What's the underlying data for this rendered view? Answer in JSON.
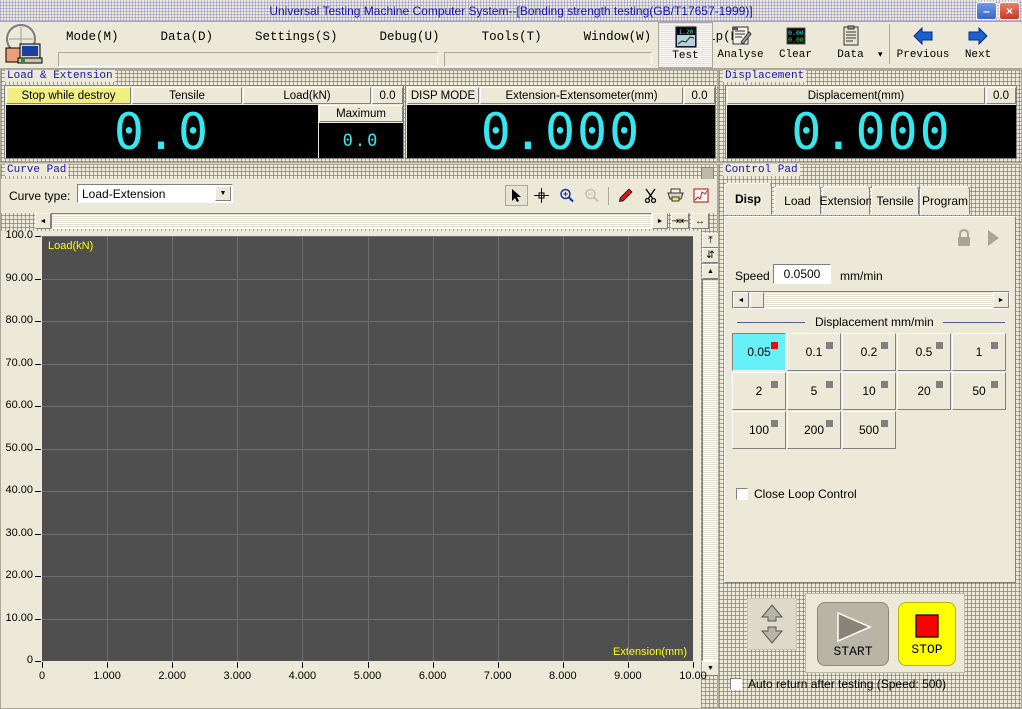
{
  "window": {
    "title": "Universal Testing Machine Computer System--[Bonding strength testing(GB/T17657-1999)]",
    "minimize_label": "–",
    "close_label": "×"
  },
  "menu": {
    "items": [
      {
        "label": "Mode(M)",
        "name": "menu-mode"
      },
      {
        "label": "Data(D)",
        "name": "menu-data"
      },
      {
        "label": "Settings(S)",
        "name": "menu-settings"
      },
      {
        "label": "Debug(U)",
        "name": "menu-debug"
      },
      {
        "label": "Tools(T)",
        "name": "menu-tools"
      },
      {
        "label": "Window(W)",
        "name": "menu-window"
      },
      {
        "label": "Help(H)",
        "name": "menu-help"
      }
    ]
  },
  "toolbar": {
    "buttons": [
      {
        "label": "Test",
        "icon": "test-chart-icon",
        "selected": true
      },
      {
        "label": "Analyse",
        "icon": "analyse-notepad-icon",
        "selected": false
      },
      {
        "label": "Clear",
        "icon": "clear-digits-icon",
        "selected": false
      },
      {
        "label": "Data",
        "icon": "data-clipboard-icon",
        "selected": false
      }
    ],
    "dropdown_label": "▾",
    "nav": [
      {
        "label": "Previous",
        "icon": "previous-arrow-icon"
      },
      {
        "label": "Next",
        "icon": "next-arrow-icon"
      }
    ]
  },
  "load_extension": {
    "group_label": "Load & Extension",
    "status_label": "Stop while destroy",
    "mode_label": "Tensile",
    "load_label": "Load(kN)",
    "load_zero": "0.0",
    "load_value": "0.0",
    "maximum_label": "Maximum",
    "maximum_value": "0.0",
    "disp_mode_label": "DISP MODE",
    "ext_label": "Extension-Extensometer(mm)",
    "ext_zero": "0.0",
    "ext_value": "0.000"
  },
  "displacement": {
    "group_label": "Displacement",
    "header_label": "Displacement(mm)",
    "zero": "0.0",
    "value": "0.000"
  },
  "curve_pad": {
    "group_label": "Curve Pad",
    "curve_type_label": "Curve type:",
    "curve_type_value": "Load-Extension",
    "combo_arrow": "▼",
    "tools": [
      {
        "name": "pointer-arrow-icon",
        "selected": true,
        "disabled": false
      },
      {
        "name": "crosshair-icon",
        "selected": false,
        "disabled": false
      },
      {
        "name": "zoom-in-icon",
        "selected": false,
        "disabled": false
      },
      {
        "name": "zoom-out-icon",
        "selected": false,
        "disabled": true
      },
      {
        "name": "pen-icon",
        "selected": false,
        "disabled": false
      },
      {
        "name": "scissors-icon",
        "selected": false,
        "disabled": false
      },
      {
        "name": "printer-icon",
        "selected": false,
        "disabled": false
      },
      {
        "name": "curve-graph-icon",
        "selected": false,
        "disabled": false
      },
      {
        "name": "stopwatch-icon",
        "selected": false,
        "disabled": false
      }
    ],
    "hscroll_left": "◄",
    "hscroll_right": "►",
    "vscroll_up": "▲",
    "vscroll_down": "▼"
  },
  "chart_data": {
    "type": "line",
    "title": "",
    "xlabel": "Extension(mm)",
    "ylabel": "Load(kN)",
    "xlim": [
      0,
      10.0
    ],
    "ylim": [
      0,
      100.0
    ],
    "grid": true,
    "legend": "none",
    "xticks": [
      "0",
      "1.000",
      "2.000",
      "3.000",
      "4.000",
      "5.000",
      "6.000",
      "7.000",
      "8.000",
      "9.000",
      "10.00"
    ],
    "yticks": [
      "0",
      "10.00",
      "20.00",
      "30.00",
      "40.00",
      "50.00",
      "60.00",
      "70.00",
      "80.00",
      "90.00",
      "100.0"
    ],
    "series": [
      {
        "name": "Load-Extension",
        "x": [],
        "y": []
      }
    ]
  },
  "control_pad": {
    "group_label": "Control Pad",
    "tabs": [
      {
        "label": "Disp",
        "active": true
      },
      {
        "label": "Load",
        "active": false
      },
      {
        "label": "Extension",
        "active": false
      },
      {
        "label": "Tensile",
        "active": false
      },
      {
        "label": "Program",
        "active": false
      }
    ],
    "lock_icon": "lock-icon",
    "play_icon": "play-icon",
    "speed_label": "Speed",
    "speed_value": "0.0500",
    "speed_unit": "mm/min",
    "scroll_left": "◄",
    "scroll_right": "►",
    "section_label": "Displacement mm/min",
    "speed_buttons": [
      {
        "label": "0.05",
        "selected": true
      },
      {
        "label": "0.1",
        "selected": false
      },
      {
        "label": "0.2",
        "selected": false
      },
      {
        "label": "0.5",
        "selected": false
      },
      {
        "label": "1",
        "selected": false
      },
      {
        "label": "2",
        "selected": false
      },
      {
        "label": "5",
        "selected": false
      },
      {
        "label": "10",
        "selected": false
      },
      {
        "label": "20",
        "selected": false
      },
      {
        "label": "50",
        "selected": false
      },
      {
        "label": "100",
        "selected": false
      },
      {
        "label": "200",
        "selected": false
      },
      {
        "label": "500",
        "selected": false
      }
    ],
    "close_loop_label": "Close Loop Control",
    "close_loop_checked": false,
    "jog_icon": "up-down-arrows-icon",
    "start_label": "START",
    "stop_label": "STOP",
    "auto_return_label": "Auto return after testing (Speed: 500)",
    "auto_return_checked": false
  },
  "colors": {
    "titlebar_text": "#1414b4",
    "lcd_fg": "#33e8ee",
    "lcd_bg": "#000000",
    "plot_bg": "#4f4f4f",
    "plot_grid": "#6e6e6e",
    "axis_caption": "#ffff00",
    "status_highlight": "#f2ef82",
    "selected_speed": "#66f0f8",
    "selected_led": "#ff0000",
    "stop_button": "#ffff00",
    "stop_square": "#ff0000",
    "face": "#ece9d8"
  }
}
